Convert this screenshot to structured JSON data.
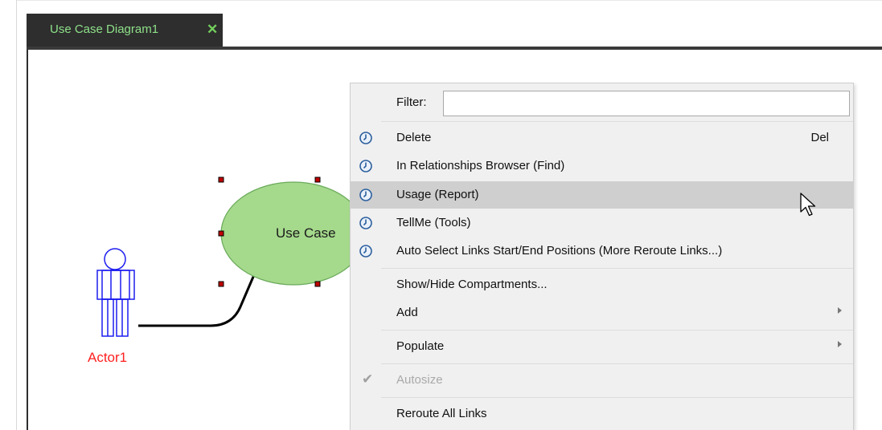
{
  "tab": {
    "title": "Use Case Diagram1",
    "close_symbol": "✕"
  },
  "diagram": {
    "actor": {
      "name": "Actor1",
      "color": "#ff2020",
      "stroke": "#1d1df0"
    },
    "usecase": {
      "name": "Use Case",
      "fill": "#a5d98c",
      "stroke": "#6aaa5a"
    }
  },
  "context_menu": {
    "filter_label": "Filter:",
    "filter_value": "",
    "items": [
      {
        "label": "Delete",
        "shortcut": "Del",
        "icon": "clock-icon"
      },
      {
        "label": "In Relationships Browser (Find)",
        "icon": "clock-icon"
      },
      {
        "label": "Usage (Report)",
        "icon": "clock-icon",
        "highlighted": true
      },
      {
        "label": "TellMe (Tools)",
        "icon": "clock-icon"
      },
      {
        "label": "Auto Select Links Start/End Positions (More Reroute Links...)",
        "icon": "clock-icon"
      },
      {
        "label": "Show/Hide Compartments..."
      },
      {
        "label": "Add",
        "submenu": true
      },
      {
        "label": "Populate",
        "submenu": true
      },
      {
        "label": "Autosize",
        "checked": true,
        "disabled": true
      },
      {
        "label": "Reroute All Links"
      }
    ]
  },
  "colors": {
    "tab_bg": "#2e2e2e",
    "tab_text": "#8ee089",
    "menu_bg": "#f0f0f0",
    "highlight": "#cfcfcf",
    "icon_blue": "#2c5f9e"
  }
}
